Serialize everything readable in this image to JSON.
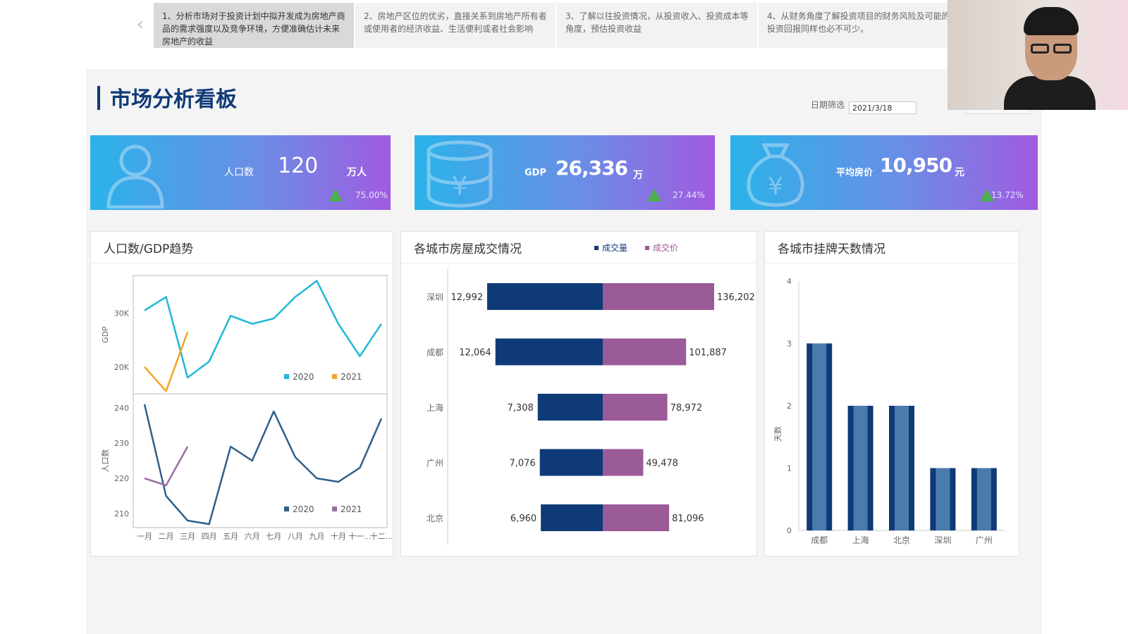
{
  "tabs": [
    "1、分析市场对于投资计划中拟开发成为房地产商品的需求强度以及竞争环境，方便准确估计未来房地产的收益",
    "2、房地产区位的优劣，直接关系到房地产所有者或使用者的经济收益、生活便利或者社会影响",
    "3、了解以往投资情况，从投资收入、投资成本等角度，预估投资收益",
    "4、从财务角度了解投资项目的财务风险及可能的投资回报同样也必不可少。"
  ],
  "header": {
    "title": "市场分析看板",
    "date_label": "日期筛选",
    "date_value": "2021/3/18"
  },
  "kpis": [
    {
      "label": "人口数",
      "value": "120",
      "unit": "万人",
      "change": "75.00%"
    },
    {
      "label": "GDP",
      "value": "26,336",
      "unit": "万",
      "change": "27.44%"
    },
    {
      "label": "平均房价",
      "value": "10,950",
      "unit": "元",
      "change": "13.72%"
    }
  ],
  "colors": {
    "dark_blue": "#0f3a78",
    "purple": "#9b5a98",
    "cyan": "#1fb8d6",
    "orange": "#f0a526",
    "steel": "#2f5f8a",
    "mauve": "#9b6fa3",
    "bar_light": "#4a7bad",
    "up_green": "#4caf50"
  },
  "panels": {
    "trend": {
      "title": "人口数/GDP趋势"
    },
    "deals": {
      "title": "各城市房屋成交情况"
    },
    "listing": {
      "title": "各城市挂牌天数情况"
    }
  },
  "chart_data": [
    {
      "type": "line",
      "title": "",
      "ylabel": "GDP",
      "ylim": [
        15000,
        37000
      ],
      "yticks": [
        20000,
        30000
      ],
      "ytick_labels": [
        "20K",
        "30K"
      ],
      "legend": [
        "2020",
        "2021"
      ],
      "legend_position": "bottom-right",
      "categories": [
        "一月",
        "二月",
        "三月",
        "四月",
        "五月",
        "六月",
        "七月",
        "八月",
        "九月",
        "十月",
        "十一...",
        "十二..."
      ],
      "series": [
        {
          "name": "2020",
          "values": [
            30500,
            33000,
            18000,
            21000,
            29500,
            28000,
            29000,
            33000,
            36000,
            28000,
            22000,
            28000
          ]
        },
        {
          "name": "2021",
          "values": [
            20000,
            15500,
            26500
          ]
        }
      ]
    },
    {
      "type": "line",
      "title": "",
      "ylabel": "人口数",
      "ylim": [
        206,
        244
      ],
      "yticks": [
        210,
        220,
        230,
        240
      ],
      "legend": [
        "2020",
        "2021"
      ],
      "legend_position": "bottom-right",
      "categories": [
        "一月",
        "二月",
        "三月",
        "四月",
        "五月",
        "六月",
        "七月",
        "八月",
        "九月",
        "十月",
        "十一...",
        "十二..."
      ],
      "series": [
        {
          "name": "2020",
          "values": [
            241,
            215,
            208,
            207,
            229,
            225,
            239,
            226,
            220,
            219,
            223,
            237
          ]
        },
        {
          "name": "2021",
          "values": [
            220,
            218,
            229
          ]
        }
      ]
    },
    {
      "type": "bar",
      "orientation": "horizontal-diverging",
      "title": "",
      "legend": [
        "成交量",
        "成交价"
      ],
      "legend_position": "top-right",
      "categories": [
        "深圳",
        "成都",
        "上海",
        "广州",
        "北京"
      ],
      "series": [
        {
          "name": "成交量",
          "values": [
            12992,
            12064,
            7308,
            7076,
            6960
          ],
          "labels": [
            "12,992",
            "12,064",
            "7,308",
            "7,076",
            "6,960"
          ]
        },
        {
          "name": "成交价",
          "values": [
            136202,
            101887,
            78972,
            49478,
            81096
          ],
          "labels": [
            "136,202",
            "101,887",
            "78,972",
            "49,478",
            "81,096"
          ]
        }
      ]
    },
    {
      "type": "bar",
      "title": "",
      "ylabel": "天数",
      "ylim": [
        0,
        4
      ],
      "yticks": [
        0,
        1,
        2,
        3,
        4
      ],
      "categories": [
        "成都",
        "上海",
        "北京",
        "深圳",
        "广州"
      ],
      "values": [
        3,
        2,
        2,
        1,
        1
      ]
    }
  ]
}
